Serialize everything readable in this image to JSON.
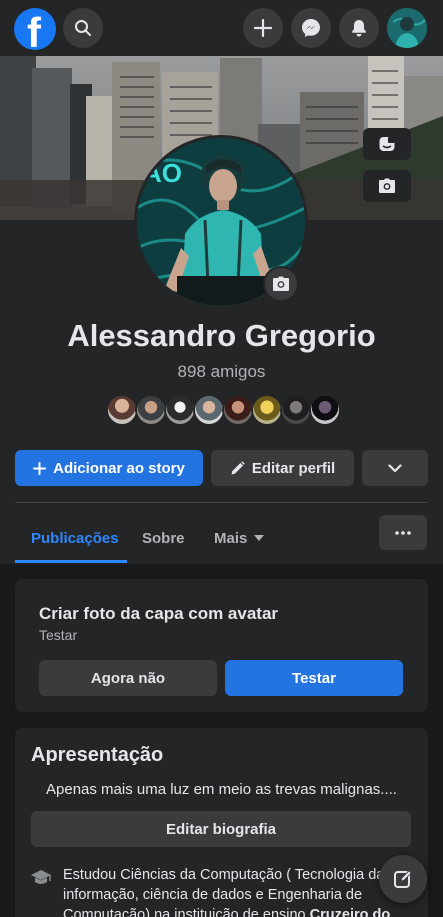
{
  "header": {
    "logo": "f",
    "icons": [
      "search-icon",
      "plus-icon",
      "messenger-icon",
      "notifications-bell-icon"
    ]
  },
  "profile": {
    "name": "Alessandro Gregorio",
    "friends_count": "898 amigos",
    "friend_avatar_count": 8
  },
  "actions": {
    "add_story": "Adicionar ao story",
    "edit_profile": "Editar perfil"
  },
  "tabs": [
    {
      "label": "Publicações",
      "active": true
    },
    {
      "label": "Sobre",
      "active": false
    },
    {
      "label": "Mais",
      "active": false
    }
  ],
  "avatar_cover_card": {
    "title": "Criar foto da capa com avatar",
    "subtitle": "Testar",
    "dismiss_label": "Agora não",
    "try_label": "Testar"
  },
  "intro": {
    "title": "Apresentação",
    "bio": "Apenas mais uma luz em meio as trevas malignas....",
    "edit_bio_label": "Editar biografia",
    "education_prefix": "Estudou Ciências da Computação ( Tecnologia da informação, ciência de dados e Engenharia de Computação) na instituição de ensino ",
    "education_school": "Cruzeiro do"
  },
  "colors": {
    "accent": "#2374e1",
    "link": "#2d88ff",
    "background": "#18191a",
    "surface": "#242526",
    "button_secondary": "#3a3b3c"
  }
}
